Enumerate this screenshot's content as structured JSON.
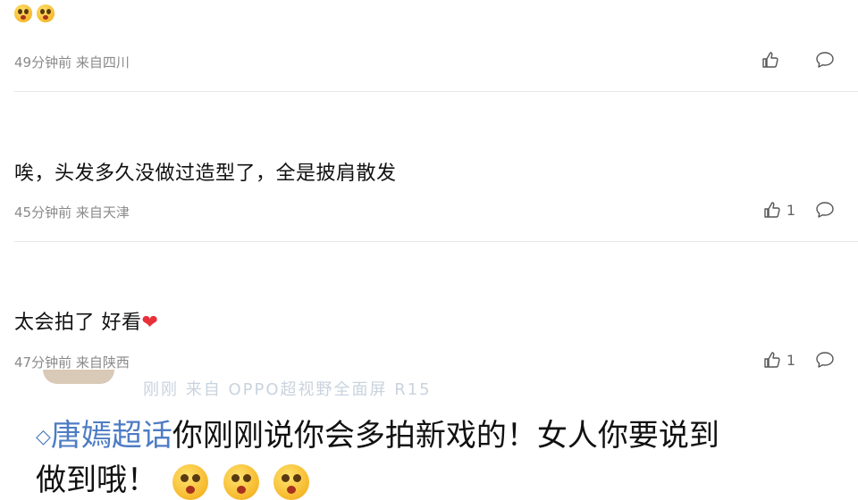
{
  "comments": [
    {
      "text": "",
      "time": "49分钟前",
      "location": "来自四川",
      "likes": "",
      "emoji_count": 2
    },
    {
      "text": "唉，头发多久没做过造型了，全是披肩散发",
      "time": "45分钟前",
      "location": "来自天津",
      "likes": "1"
    },
    {
      "text": "太会拍了 好看",
      "time": "47分钟前",
      "location": "来自陕西",
      "likes": "1",
      "trailing_icon": "heart-icon"
    }
  ],
  "overlay": {
    "ghost_text": "刚刚 来自 OPPO超视野全面屏 R15",
    "topic_label": "唐嫣超话",
    "line1_rest": "你刚刚说你会多拍新戏的！女人你要说到",
    "line2": "做到哦！",
    "emoji_count": 3
  },
  "colors": {
    "meta_text": "#8a8a8a",
    "topic_blue": "#4d7cc4",
    "heart_red": "#e8303a",
    "divider": "#e8e8e8"
  }
}
